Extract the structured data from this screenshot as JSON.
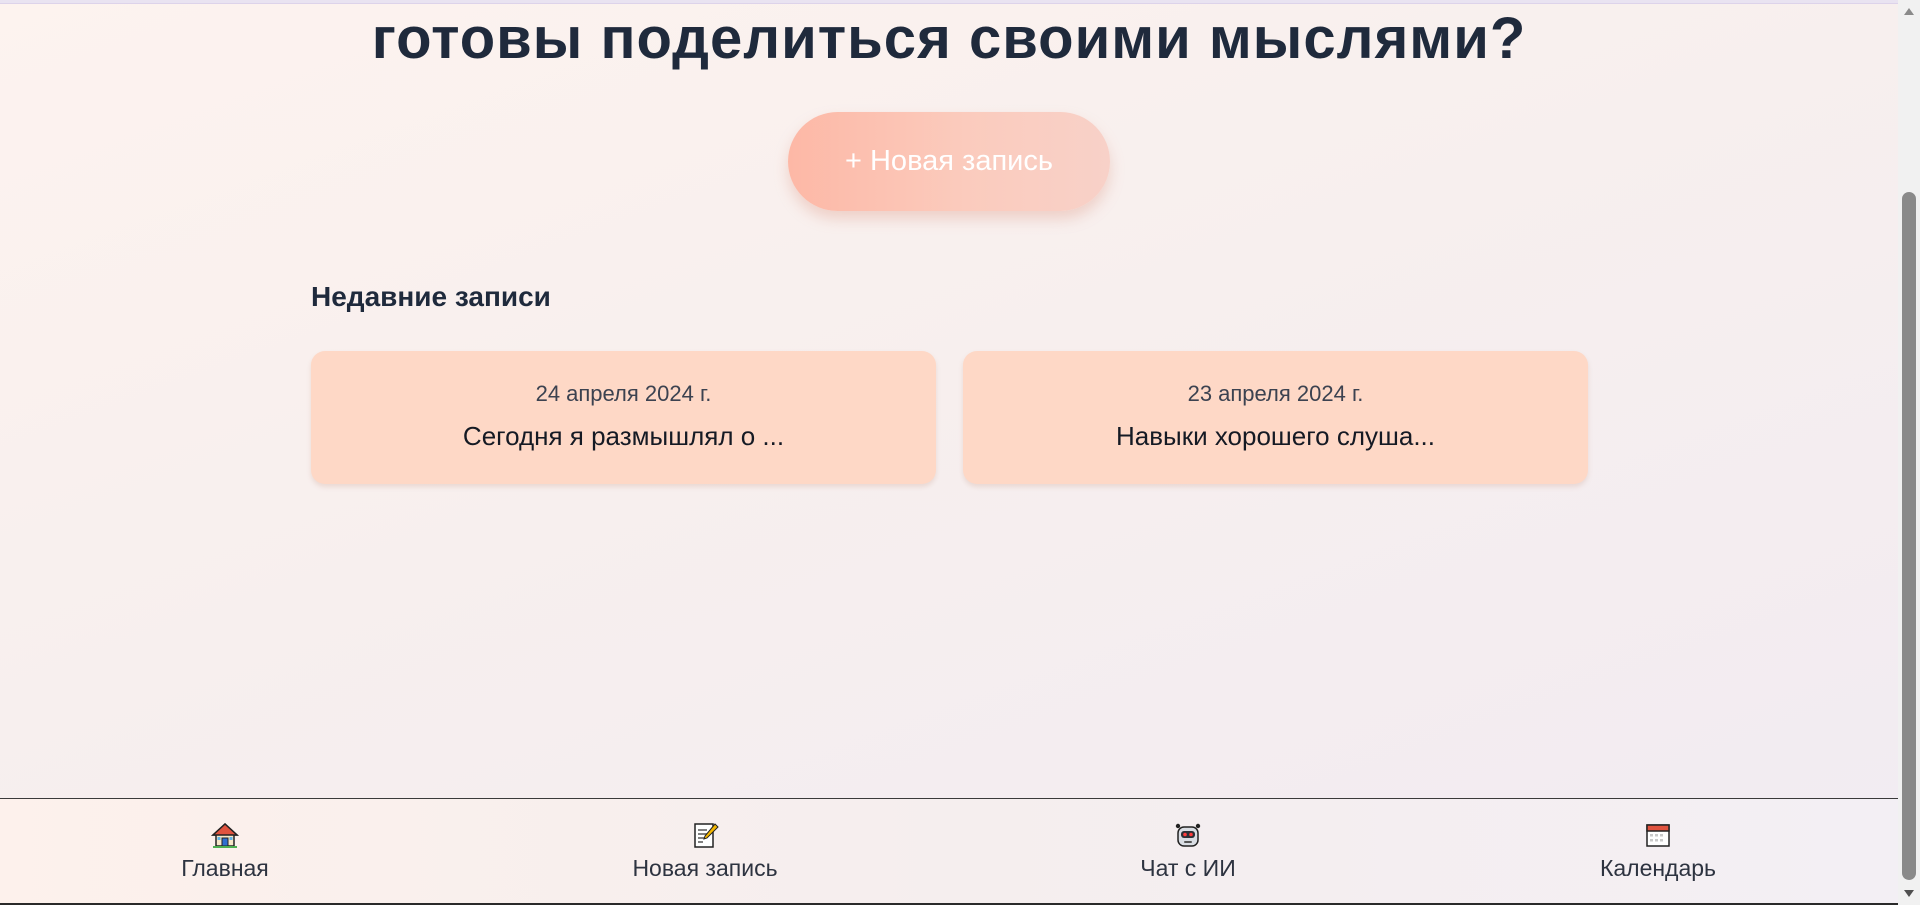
{
  "main": {
    "heading": "готовы поделиться своими мыслями?",
    "new_entry_button": "+ Новая запись",
    "recent_title": "Недавние записи",
    "entries": [
      {
        "date": "24 апреля 2024 г.",
        "preview": "Сегодня я размышлял о ..."
      },
      {
        "date": "23 апреля 2024 г.",
        "preview": "Навыки хорошего слуша..."
      }
    ]
  },
  "nav": {
    "items": [
      {
        "label": "Главная",
        "icon": "house-icon"
      },
      {
        "label": "Новая запись",
        "icon": "memo-icon"
      },
      {
        "label": "Чат с ИИ",
        "icon": "robot-icon"
      },
      {
        "label": "Календарь",
        "icon": "calendar-icon"
      }
    ]
  },
  "colors": {
    "heading": "#1f2a3c",
    "button_start": "#fdb8a6",
    "button_end": "#f8d1c8",
    "card": "#fed8c6"
  }
}
